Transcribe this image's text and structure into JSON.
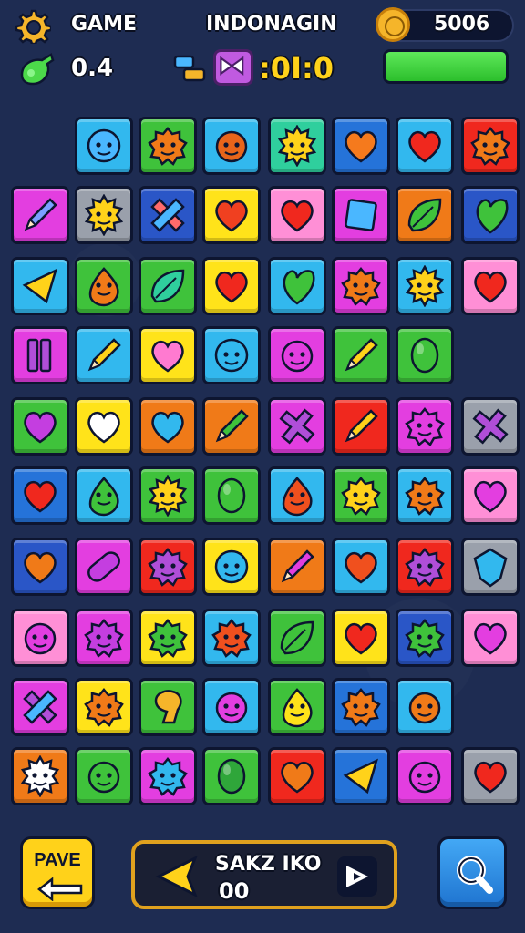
{
  "hud": {
    "game_label": "GAME",
    "title": "INDONAGIN",
    "coins": "5006",
    "gems": "0.4",
    "timer": ":0I:0",
    "energy_fraction": 1.0
  },
  "colors": {
    "background": "#1e2c52",
    "accent_yellow": "#ffd21a",
    "energy_green": "#4cd94a",
    "tile_palette": {
      "cyan": "#32b8ee",
      "green": "#3fc23b",
      "teal": "#2fcf9d",
      "blue": "#2573d9",
      "orange": "#f07a18",
      "magenta": "#e33ee0",
      "pink": "#ff8fd6",
      "purple": "#b04ed8",
      "yellow": "#ffe31a",
      "gray": "#9aa0ab",
      "red": "#f0281e",
      "navy": "#2a56c7"
    }
  },
  "board": {
    "rows": [
      [
        null,
        {
          "bg": "cyan",
          "icon": "blob-face",
          "fill": "#4ab7ff"
        },
        {
          "bg": "green",
          "icon": "flower-face",
          "fill": "#f07a18"
        },
        {
          "bg": "cyan",
          "icon": "round-face",
          "fill": "#e8651a"
        },
        {
          "bg": "teal",
          "icon": "sun-face",
          "fill": "#ffd21a"
        },
        {
          "bg": "blue",
          "icon": "heart",
          "fill": "#f57a1d"
        },
        {
          "bg": "cyan",
          "icon": "heart",
          "fill": "#f0281e"
        },
        {
          "bg": "red",
          "icon": "flower-face",
          "fill": "#f07a18"
        }
      ],
      [
        {
          "bg": "magenta",
          "icon": "pencil",
          "fill": "#7aa0ff"
        },
        {
          "bg": "gray",
          "icon": "sun-face",
          "fill": "#ffd21a"
        },
        {
          "bg": "navy",
          "icon": "cross-pencil",
          "fill": "#ff6b6b"
        },
        {
          "bg": "yellow",
          "icon": "heart",
          "fill": "#f04020"
        },
        {
          "bg": "pink",
          "icon": "heart",
          "fill": "#f0281e"
        },
        {
          "bg": "magenta",
          "icon": "square",
          "fill": "#4ab7ff"
        },
        {
          "bg": "orange",
          "icon": "leaf",
          "fill": "#3fc23b"
        },
        {
          "bg": "navy",
          "icon": "leaf-heart",
          "fill": "#3fc23b"
        }
      ],
      [
        {
          "bg": "cyan",
          "icon": "triangle",
          "fill": "#ffd21a"
        },
        {
          "bg": "green",
          "icon": "drop-face",
          "fill": "#f07a18"
        },
        {
          "bg": "green",
          "icon": "leaf",
          "fill": "#2fcf9d"
        },
        {
          "bg": "yellow",
          "icon": "heart",
          "fill": "#f0281e"
        },
        {
          "bg": "cyan",
          "icon": "leaf-heart",
          "fill": "#3fc23b"
        },
        {
          "bg": "magenta",
          "icon": "flower-face",
          "fill": "#f07a18"
        },
        {
          "bg": "cyan",
          "icon": "sun-face",
          "fill": "#ffd21a"
        },
        {
          "bg": "pink",
          "icon": "heart",
          "fill": "#f0281e"
        }
      ],
      [
        {
          "bg": "magenta",
          "icon": "bars",
          "fill": "#b04ed8"
        },
        {
          "bg": "cyan",
          "icon": "pencil",
          "fill": "#ffd21a"
        },
        {
          "bg": "yellow",
          "icon": "heart",
          "fill": "#ff7ad0"
        },
        {
          "bg": "cyan",
          "icon": "blob-face",
          "fill": "#32b8ee"
        },
        {
          "bg": "magenta",
          "icon": "round-face",
          "fill": "#e33ee0"
        },
        {
          "bg": "green",
          "icon": "pencil",
          "fill": "#ffd21a"
        },
        {
          "bg": "green",
          "icon": "bean",
          "fill": "#3fc23b"
        },
        null
      ],
      [
        {
          "bg": "green",
          "icon": "heart",
          "fill": "#c43ee0"
        },
        {
          "bg": "yellow",
          "icon": "heart",
          "fill": "#ffffff"
        },
        {
          "bg": "orange",
          "icon": "heart",
          "fill": "#32b8ee"
        },
        {
          "bg": "orange",
          "icon": "pencil",
          "fill": "#3fc23b"
        },
        {
          "bg": "magenta",
          "icon": "cross",
          "fill": "#b04ed8"
        },
        {
          "bg": "red",
          "icon": "pencil",
          "fill": "#ffd21a"
        },
        {
          "bg": "magenta",
          "icon": "flower-face",
          "fill": "#e33ee0"
        },
        {
          "bg": "gray",
          "icon": "cross",
          "fill": "#b04ed8"
        }
      ],
      [
        {
          "bg": "blue",
          "icon": "heart",
          "fill": "#f0281e"
        },
        {
          "bg": "cyan",
          "icon": "drop-face",
          "fill": "#3fc23b"
        },
        {
          "bg": "green",
          "icon": "sun-face",
          "fill": "#ffd21a"
        },
        {
          "bg": "green",
          "icon": "bean",
          "fill": "#3fc23b"
        },
        {
          "bg": "cyan",
          "icon": "drop-face",
          "fill": "#f0501e"
        },
        {
          "bg": "green",
          "icon": "flower-face",
          "fill": "#ffd21a"
        },
        {
          "bg": "cyan",
          "icon": "flower-face",
          "fill": "#f07a18"
        },
        {
          "bg": "pink",
          "icon": "heart",
          "fill": "#e33ee0"
        }
      ],
      [
        {
          "bg": "navy",
          "icon": "heart",
          "fill": "#f07a18"
        },
        {
          "bg": "magenta",
          "icon": "capsule",
          "fill": "#c43ee0"
        },
        {
          "bg": "red",
          "icon": "flower-face",
          "fill": "#b04ed8"
        },
        {
          "bg": "yellow",
          "icon": "blob-face",
          "fill": "#32b8ee"
        },
        {
          "bg": "orange",
          "icon": "pencil",
          "fill": "#e33ee0"
        },
        {
          "bg": "cyan",
          "icon": "heart",
          "fill": "#f0501e"
        },
        {
          "bg": "red",
          "icon": "flower-face",
          "fill": "#b04ed8"
        },
        {
          "bg": "gray",
          "icon": "shield",
          "fill": "#32b8ee"
        }
      ],
      [
        {
          "bg": "pink",
          "icon": "round-face",
          "fill": "#e33ee0"
        },
        {
          "bg": "magenta",
          "icon": "flower-face",
          "fill": "#c43ee0"
        },
        {
          "bg": "yellow",
          "icon": "flower-face",
          "fill": "#3fc23b"
        },
        {
          "bg": "cyan",
          "icon": "flower-face",
          "fill": "#f0501e"
        },
        {
          "bg": "green",
          "icon": "leaf",
          "fill": "#3fc23b"
        },
        {
          "bg": "yellow",
          "icon": "heart",
          "fill": "#f0281e"
        },
        {
          "bg": "navy",
          "icon": "flower-face",
          "fill": "#3fc23b"
        },
        {
          "bg": "pink",
          "icon": "heart",
          "fill": "#e33ee0"
        }
      ],
      [
        {
          "bg": "magenta",
          "icon": "cross-pencil",
          "fill": "#b04ed8"
        },
        {
          "bg": "yellow",
          "icon": "flower-face",
          "fill": "#f07a18"
        },
        {
          "bg": "green",
          "icon": "bell",
          "fill": "#f5b52a"
        },
        {
          "bg": "cyan",
          "icon": "round-face",
          "fill": "#e33ee0"
        },
        {
          "bg": "green",
          "icon": "drop-face",
          "fill": "#ffe31a"
        },
        {
          "bg": "blue",
          "icon": "flower-face",
          "fill": "#f07a18"
        },
        {
          "bg": "cyan",
          "icon": "round-face",
          "fill": "#f07a18"
        },
        null
      ],
      [
        {
          "bg": "orange",
          "icon": "sun-face",
          "fill": "#ffffff"
        },
        {
          "bg": "green",
          "icon": "round-face",
          "fill": "#3fc23b"
        },
        {
          "bg": "magenta",
          "icon": "flower-face",
          "fill": "#32b8ee"
        },
        {
          "bg": "green",
          "icon": "bean",
          "fill": "#2fa63a"
        },
        {
          "bg": "red",
          "icon": "heart",
          "fill": "#f07a18"
        },
        {
          "bg": "blue",
          "icon": "triangle",
          "fill": "#ffd21a"
        },
        {
          "bg": "magenta",
          "icon": "round-face",
          "fill": "#e33ee0"
        },
        {
          "bg": "gray",
          "icon": "heart",
          "fill": "#f0281e"
        }
      ]
    ]
  },
  "bottom": {
    "left_button_label": "PAVE",
    "panel_title": "SAKZ IKO",
    "panel_value": "00"
  }
}
